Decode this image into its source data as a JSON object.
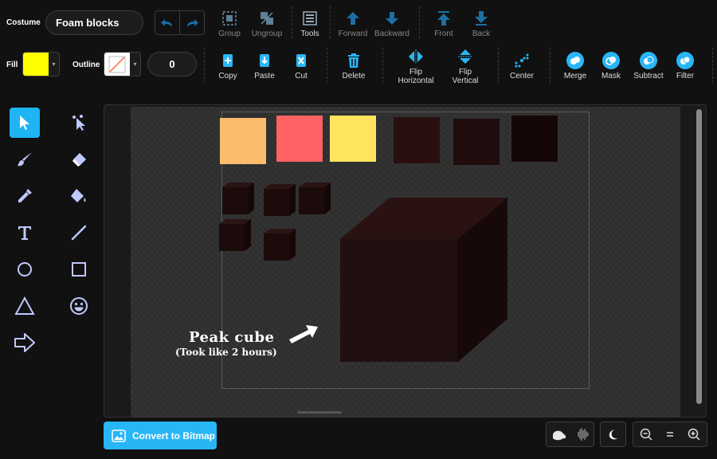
{
  "costume": {
    "label": "Costume",
    "name": "Foam blocks"
  },
  "fill": {
    "label": "Fill",
    "color": "#ffff00"
  },
  "outline": {
    "label": "Outline",
    "width": "0"
  },
  "toolbar_row1": [
    {
      "label": "Group",
      "icon": "group-icon"
    },
    {
      "label": "Ungroup",
      "icon": "ungroup-icon"
    },
    {
      "label": "Tools",
      "icon": "tools-icon"
    },
    {
      "label": "Forward",
      "icon": "forward-icon"
    },
    {
      "label": "Backward",
      "icon": "backward-icon"
    },
    {
      "label": "Front",
      "icon": "front-icon"
    },
    {
      "label": "Back",
      "icon": "back-icon"
    }
  ],
  "toolbar_row2": [
    {
      "label": "Copy",
      "icon": "copy-icon"
    },
    {
      "label": "Paste",
      "icon": "paste-icon"
    },
    {
      "label": "Cut",
      "icon": "cut-icon"
    },
    {
      "label": "Delete",
      "icon": "delete-icon"
    },
    {
      "label": "Flip Horizontal",
      "icon": "flip-horizontal-icon"
    },
    {
      "label": "Flip Vertical",
      "icon": "flip-vertical-icon"
    },
    {
      "label": "Center",
      "icon": "center-icon"
    },
    {
      "label": "Merge",
      "icon": "merge-icon"
    },
    {
      "label": "Mask",
      "icon": "mask-icon"
    },
    {
      "label": "Subtract",
      "icon": "subtract-icon"
    },
    {
      "label": "Filter",
      "icon": "filter-icon"
    }
  ],
  "canvas": {
    "caption_main": "Peak cube",
    "caption_sub": "(Took like 2 hours)",
    "swatch_colors": [
      "#fbbd6b",
      "#ff6363",
      "#ffe55e",
      "#2a0f0f",
      "#1f0d0d",
      "#150707"
    ],
    "cube_color": "#201010"
  },
  "convert_button": "Convert to Bitmap",
  "accent_color": "#29b6f6"
}
